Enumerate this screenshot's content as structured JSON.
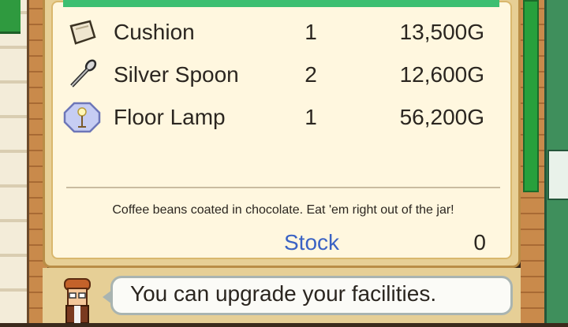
{
  "items": [
    {
      "name": "Cushion",
      "qty": "1",
      "price": "13,500G",
      "icon": "cushion-icon"
    },
    {
      "name": "Silver Spoon",
      "qty": "2",
      "price": "12,600G",
      "icon": "spoon-icon"
    },
    {
      "name": "Floor Lamp",
      "qty": "1",
      "price": "56,200G",
      "icon": "lamp-icon"
    }
  ],
  "description": "Coffee beans coated in chocolate. Eat 'em right out of the jar!",
  "stock": {
    "label": "Stock",
    "value": "0"
  },
  "message": "You can upgrade your facilities.",
  "colors": {
    "accent": "#3cbf71",
    "stock_label": "#3a62c4",
    "panel": "#fff7df"
  }
}
